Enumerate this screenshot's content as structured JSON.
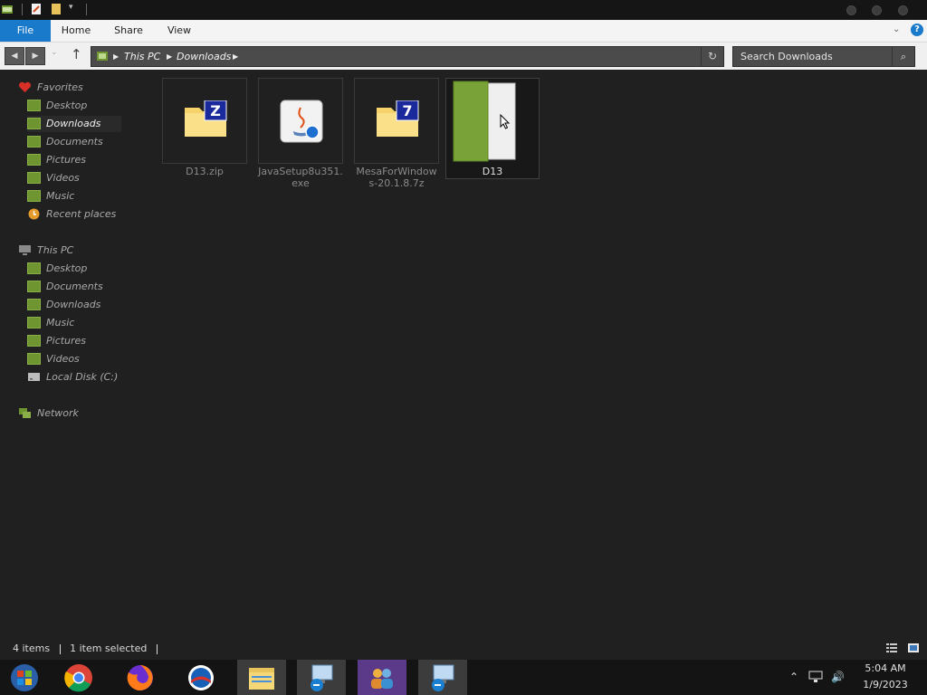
{
  "window": {
    "ribbon_tabs": [
      "File",
      "Home",
      "Share",
      "View"
    ],
    "help_label": "?"
  },
  "address": {
    "crumbs": [
      "This PC",
      "Downloads"
    ]
  },
  "search": {
    "placeholder": "Search Downloads"
  },
  "nav": {
    "favorites": {
      "label": "Favorites",
      "items": [
        "Desktop",
        "Downloads",
        "Documents",
        "Pictures",
        "Videos",
        "Music",
        "Recent places"
      ]
    },
    "this_pc": {
      "label": "This PC",
      "items": [
        "Desktop",
        "Documents",
        "Downloads",
        "Music",
        "Pictures",
        "Videos",
        "Local Disk (C:)"
      ]
    },
    "network": {
      "label": "Network"
    }
  },
  "files": [
    {
      "name": "D13.zip"
    },
    {
      "name_line1": "JavaSetup8u351.",
      "name_line2": "exe"
    },
    {
      "name_line1": "MesaForWindow",
      "name_line2": "s-20.1.8.7z"
    },
    {
      "name": "D13"
    }
  ],
  "status": {
    "items_count": "4 items",
    "selection": "1 item selected"
  },
  "taskbar": {
    "apps": [
      "start",
      "chrome",
      "firefox",
      "mail",
      "file-explorer",
      "remote-desktop",
      "users",
      "remote-desktop-2"
    ]
  },
  "clock": {
    "time": "5:04 AM",
    "date": "1/9/2023"
  },
  "colors": {
    "file_tab": "#1979ca",
    "folder_green": "#6f9530",
    "background": "#202020"
  }
}
